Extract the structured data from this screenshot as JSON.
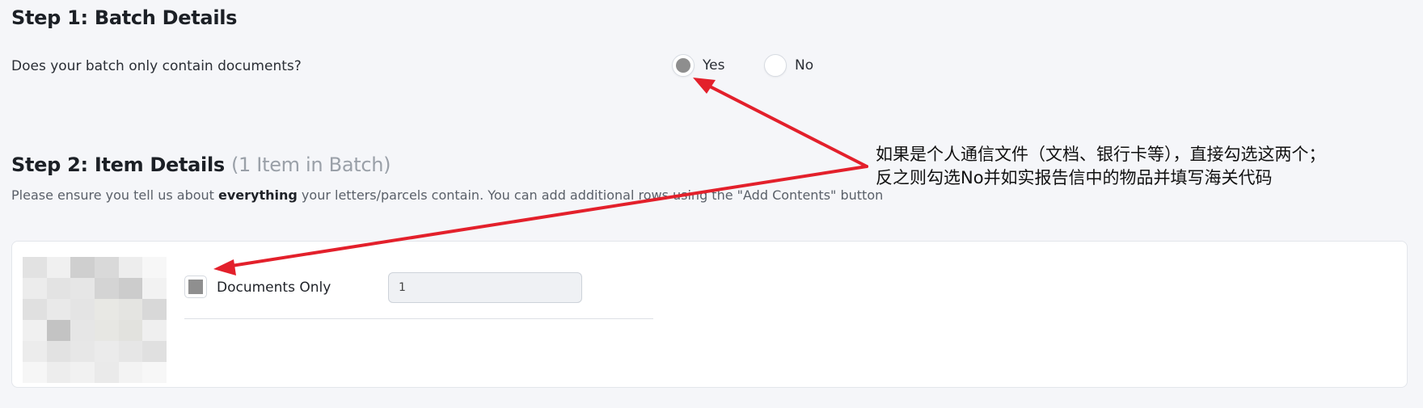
{
  "step1": {
    "title": "Step 1: Batch Details",
    "question": "Does your batch only contain documents?",
    "options": [
      {
        "label": "Yes",
        "selected": true
      },
      {
        "label": "No",
        "selected": false
      }
    ]
  },
  "step2": {
    "title": "Step 2: Item Details",
    "subtitle": "(1 Item in Batch)",
    "instructions_pre": "Please ensure you tell us about ",
    "instructions_bold": "everything",
    "instructions_post": " your letters/parcels contain. You can add additional rows using the \"Add Contents\" button",
    "item": {
      "checkbox_label": "Documents Only",
      "checked": true,
      "quantity_value": "1"
    }
  },
  "annotation": {
    "line1": "如果是个人通信文件（文档、银行卡等），直接勾选这两个；",
    "line2": "反之则勾选No并如实报告信中的物品并填写海关代码",
    "color": "#e3202b"
  },
  "colors": {
    "background": "#f5f6f9",
    "selected_indicator": "#8e8e8e",
    "annotation_arrow": "#e3202b"
  },
  "icons": {
    "radio_selected": "radio-selected-icon",
    "radio_unselected": "radio-unselected-icon",
    "checkbox_checked": "checkbox-checked-icon",
    "blurred_image": "blurred-thumbnail"
  }
}
